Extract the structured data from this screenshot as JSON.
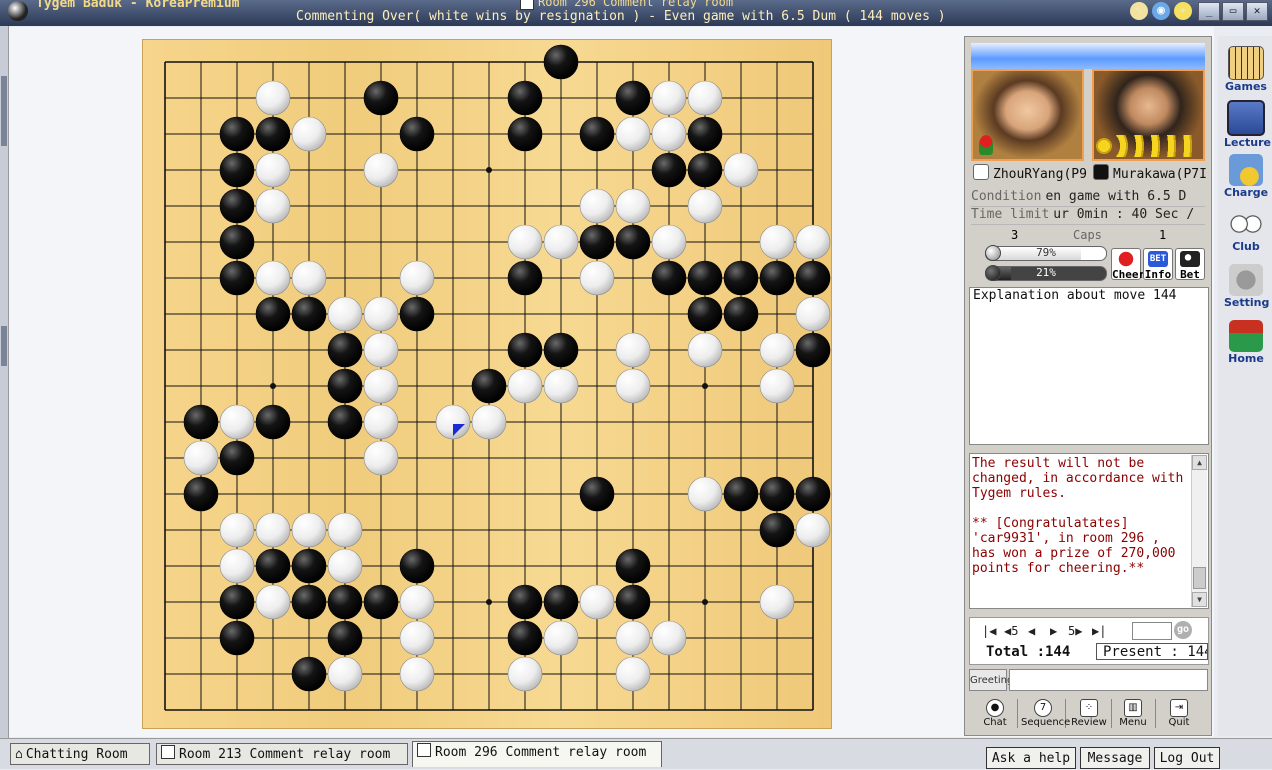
{
  "window": {
    "app_title": "Tygem Baduk - KoreaPremium",
    "room_title": "Room 296 Comment relay room",
    "status_line": "Commenting Over( white wins by resignation ) - Even game with 6.5 Dum  ( 144 moves )"
  },
  "players": {
    "white": {
      "name": "ZhouRYang(P9"
    },
    "black": {
      "name": "Murakawa(P7I"
    }
  },
  "game_info": {
    "condition_label": "Condition",
    "condition_value": "en game with 6.5 D",
    "time_label": "Time limit",
    "time_value": "ur 0min : 40 Sec /",
    "caps_label": "Caps",
    "caps_white": "3",
    "caps_black": "1",
    "cheer_white_pct": 79,
    "cheer_white_label": "79%",
    "cheer_black_pct": 21,
    "cheer_black_label": "21%"
  },
  "action_buttons": {
    "cheer": "Cheer",
    "info": "Info",
    "bet": "Bet",
    "bet_icon_text": "BET"
  },
  "explanation": {
    "text": "Explanation about move 144"
  },
  "chat_messages": [
    "The result will not be changed, in accordance with Tygem rules.",
    "** [Congratulatates] 'car9931', in room 296 , has won a prize of 270,000 points for cheering.**"
  ],
  "navigation": {
    "first": "|◀",
    "back5": "◀5",
    "back1": "◀",
    "fwd1": "▶",
    "fwd5": "5▶",
    "last": "▶|",
    "go_label": "go",
    "total_label": "Total :144",
    "present_label": "Present : 144"
  },
  "greeting": {
    "label": "Greeting"
  },
  "bottom_tools": [
    "Chat",
    "Sequence",
    "Review",
    "Menu",
    "Quit"
  ],
  "side_menu": [
    "Games",
    "Lecture",
    "Charge",
    "Club",
    "Setting",
    "Home"
  ],
  "tabs": [
    "Chatting Room",
    "Room 213 Comment relay room",
    "Room 296 Comment relay room"
  ],
  "bottom_right_buttons": [
    "Ask a help",
    "Message",
    "Log Out"
  ],
  "board": {
    "size": 19,
    "last_move_marker_color": "#1a2ad8",
    "last_move": [
      8,
      10
    ],
    "rows": [
      "...........X.......",
      "...O..X...X..XOO...",
      "..XXO..X..X.XOOX...",
      "..XO..O.......XXO..O...",
      "..XO........OO.O...O.",
      "..X.......OOXXO..OO.O",
      "..XOO..O..X.O.XXXXXO.",
      "...XXOOX.......XX.OX.",
      ".....XO...XX.O.O.OX.X.",
      ".....XO..XOO.O...O..X.",
      ".XOX.XO..O.........OO.OO",
      ".OX...O.............XXOXO",
      ".X..........X..OXXX....",
      "..OOOO...........XOOX..",
      "..OXXO.X.....X.......",
      "..XOXXXO..XXOX...O..X",
      "..X..X.O..XO.OO.....",
      "....XO.O..O..O......",
      "..................."
    ]
  }
}
